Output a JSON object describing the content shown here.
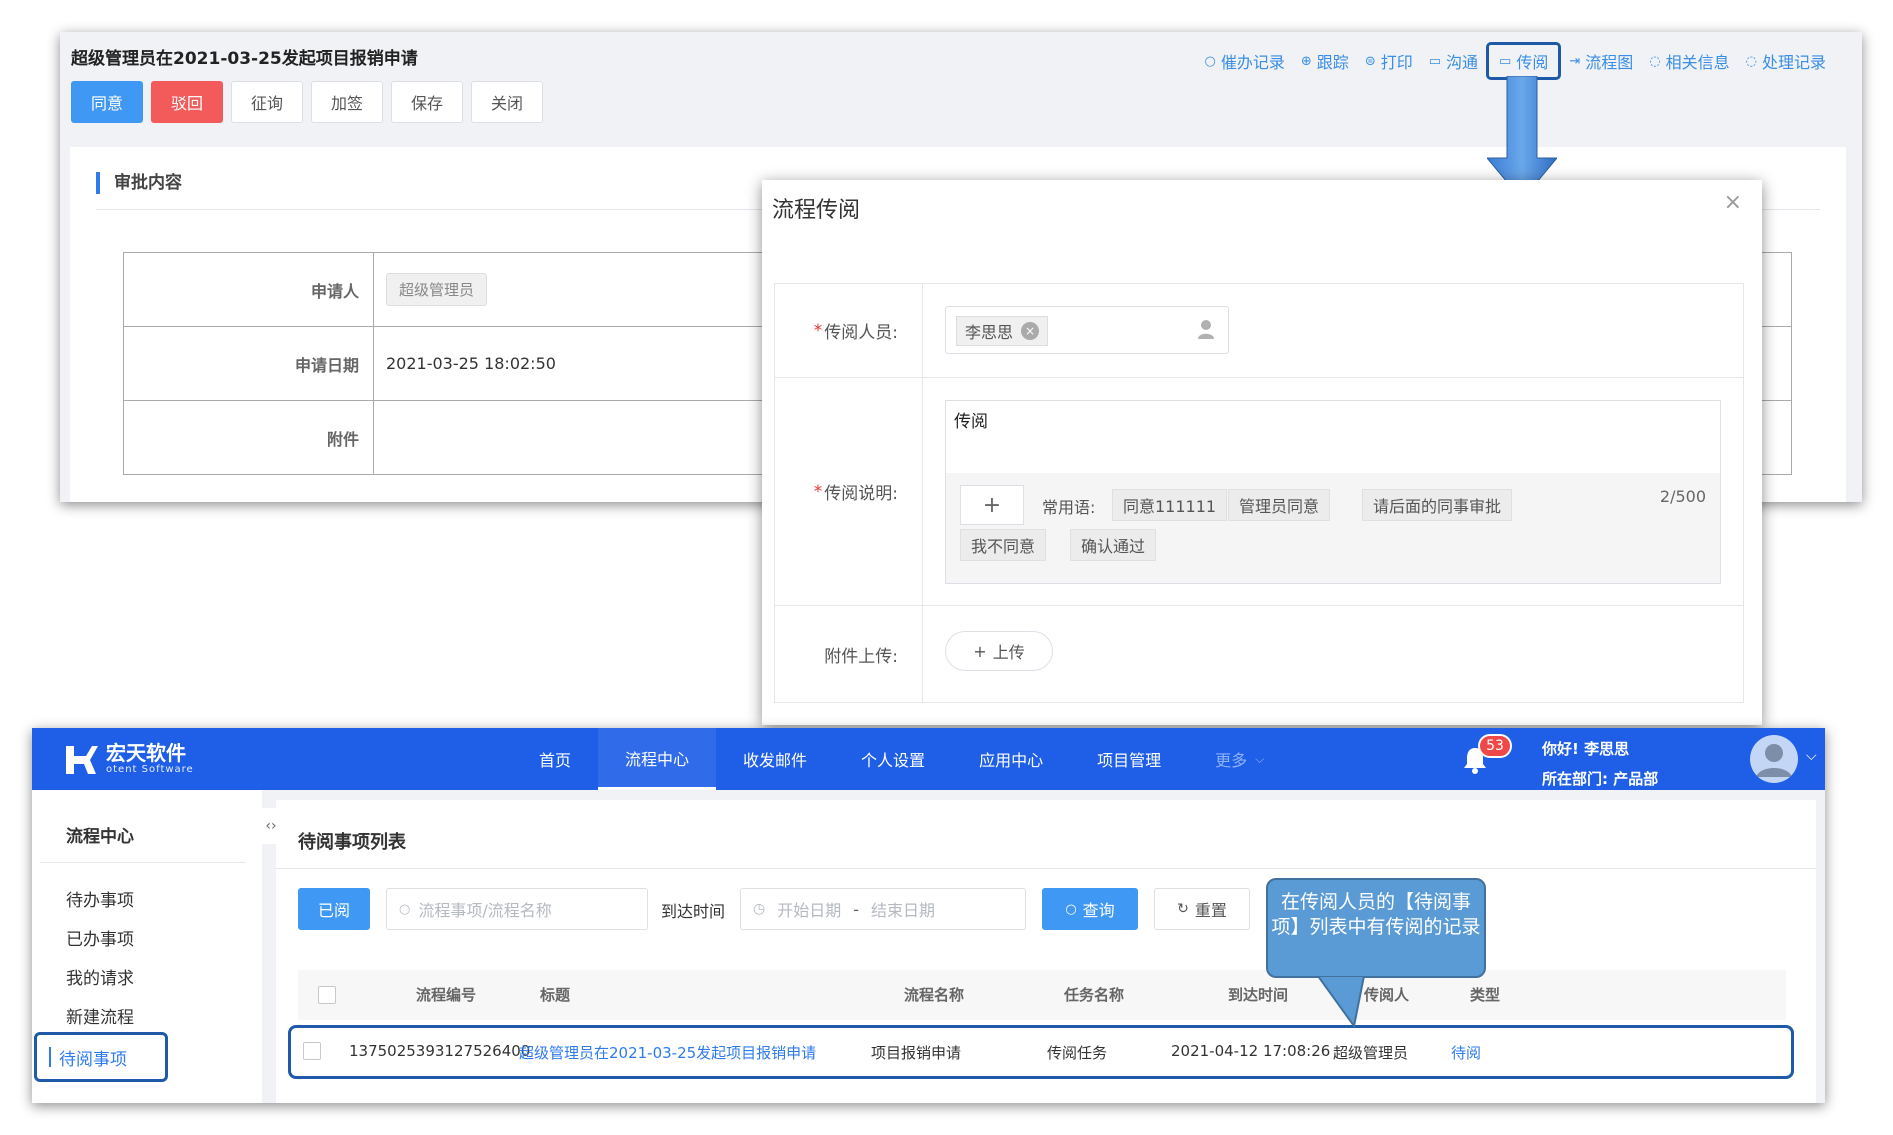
{
  "approval": {
    "title": "超级管理员在2021-03-25发起项目报销申请",
    "toolbar": [
      {
        "label": "催办记录",
        "icon": "search-icon",
        "glyph": "○"
      },
      {
        "label": "跟踪",
        "icon": "target-icon",
        "glyph": "⊕"
      },
      {
        "label": "打印",
        "icon": "print-icon",
        "glyph": "⊜"
      },
      {
        "label": "沟通",
        "icon": "chat-icon",
        "glyph": "▭"
      },
      {
        "label": "传阅",
        "icon": "folder-icon",
        "glyph": "▭"
      },
      {
        "label": "流程图",
        "icon": "flow-icon",
        "glyph": "⇥"
      },
      {
        "label": "相关信息",
        "icon": "message-icon",
        "glyph": "◌"
      },
      {
        "label": "处理记录",
        "icon": "message-icon",
        "glyph": "◌"
      }
    ],
    "buttons": {
      "agree": "同意",
      "reject": "驳回",
      "consult": "征询",
      "countersign": "加签",
      "save": "保存",
      "close": "关闭"
    },
    "section_title": "审批内容",
    "fields": {
      "applicant_label": "申请人",
      "applicant_value": "超级管理员",
      "date_label": "申请日期",
      "date_value": "2021-03-25 18:02:50",
      "attachment_label": "附件"
    }
  },
  "modal": {
    "title": "流程传阅",
    "close_glyph": "×",
    "person_label": "传阅人员:",
    "person_value": "李思思",
    "desc_label": "传阅说明:",
    "desc_value": "传阅",
    "add_glyph": "+",
    "phrase_label": "常用语:",
    "phrases": [
      "同意111111",
      "管理员同意",
      "请后面的同事审批",
      "我不同意",
      "确认通过"
    ],
    "counter": "2/500",
    "upload_label": "附件上传:",
    "upload_button": "上传",
    "required_mark": "*"
  },
  "app": {
    "brand_name": "宏天软件",
    "brand_sub": "otent Software",
    "nav": [
      "首页",
      "流程中心",
      "收发邮件",
      "个人设置",
      "应用中心",
      "项目管理",
      "更多"
    ],
    "active_nav": 1,
    "notification_count": "53",
    "greeting": "你好! 李思思",
    "department": "所在部门: 产品部",
    "sidebar": {
      "title": "流程中心",
      "items": [
        "待办事项",
        "已办事项",
        "我的请求",
        "新建流程",
        "待阅事项"
      ]
    },
    "list": {
      "title": "待阅事项列表",
      "read_button": "已阅",
      "search_placeholder": "流程事项/流程名称",
      "arrive_label": "到达时间",
      "start_placeholder": "开始日期",
      "date_separator": "-",
      "end_placeholder": "结束日期",
      "query_button": "查询",
      "reset_button": "重置",
      "columns": [
        "流程编号",
        "标题",
        "流程名称",
        "任务名称",
        "到达时间",
        "传阅人",
        "类型"
      ],
      "rows": [
        {
          "id": "1375025393127526400",
          "title": "超级管理员在2021-03-25发起项目报销申请",
          "process": "项目报销申请",
          "task": "传阅任务",
          "time": "2021-04-12 17:08:26",
          "sender": "超级管理员",
          "type": "待阅"
        }
      ]
    }
  },
  "callout": {
    "text": "在传阅人员的【待阅事项】列表中有传阅的记录"
  },
  "colors": {
    "primary": "#4098f5",
    "danger": "#f35a5a",
    "header": "#1f5fe8",
    "highlight_border": "#1e5aa8",
    "callout": "#5b9bd5"
  }
}
